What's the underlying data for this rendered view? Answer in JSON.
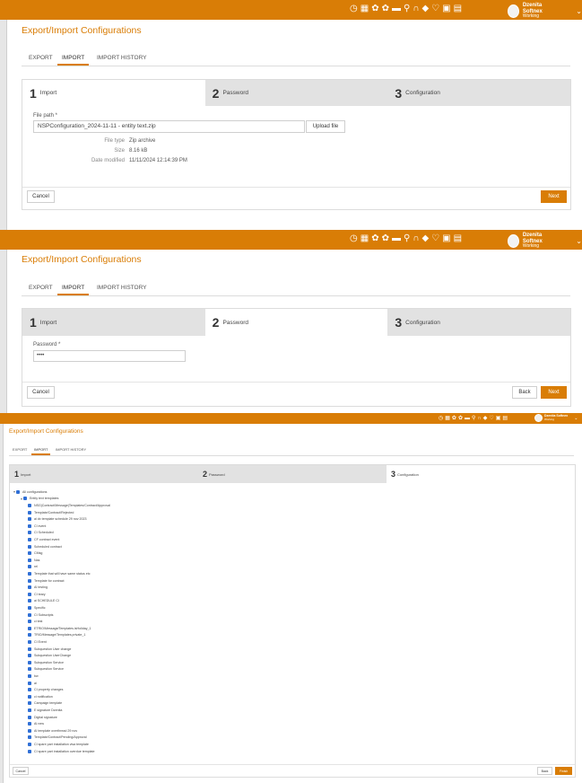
{
  "user": {
    "name": "Dzenita Softnex",
    "status": "Working"
  },
  "topbar_icons": [
    "clock-icon",
    "map-icon",
    "flower-icon",
    "flower-icon",
    "card-icon",
    "search-icon",
    "headset-icon",
    "tag-icon",
    "heart-icon",
    "calendar-icon",
    "chat-icon"
  ],
  "page": {
    "title": "Export/Import Configurations"
  },
  "tabs": [
    "EXPORT",
    "IMPORT",
    "IMPORT HISTORY"
  ],
  "steps": [
    {
      "num": "1",
      "label": "Import"
    },
    {
      "num": "2",
      "label": "Password"
    },
    {
      "num": "3",
      "label": "Configuration"
    }
  ],
  "import_step": {
    "file_path_label": "File path *",
    "file_path_value": "NSPConfiguration_2024-11-11 - entity text.zip",
    "upload_label": "Upload file",
    "info": [
      {
        "label": "File type",
        "value": "Zip archive"
      },
      {
        "label": "Size",
        "value": "8.16 kB"
      },
      {
        "label": "Date modified",
        "value": "11/11/2024 12:14:39 PM"
      }
    ]
  },
  "password_step": {
    "label": "Password *",
    "value": "••••"
  },
  "buttons": {
    "cancel": "Cancel",
    "next": "Next",
    "back": "Back",
    "finish": "Finish"
  },
  "config_tree": {
    "root": "All configurations",
    "group": "Entity text templates",
    "items": [
      "NSG|Contract/Message|Templates/Contract/Approval",
      "Template/Contract/Rejected",
      "ai dx template schedule 29 nov 2023",
      "CI event",
      "CI Scheduled",
      "CF contract event",
      "Scheduled contract",
      "CMsg",
      "Nas",
      "rel",
      "Template that will have same status etc",
      "Template for contract",
      "AI testing",
      "CI teary",
      "ai SCHEDULE CI",
      "Specific",
      "CI Subscripts",
      "ci test",
      "ETRIO/Message/Templates.isHoliday_1",
      "TRIO/Message/Templates.private_1",
      "CI Event",
      "Subquestion User change",
      "Subquestion UserChange",
      "Subquestion Service",
      "Subquestion Service",
      "bw",
      "ai",
      "CI property changes",
      "ci notification",
      "Campaign template",
      "E signature Dzenita",
      "Digital signature",
      "AI new",
      "AI template overthread 29 nov",
      "Template/Contract/Pending/Approval",
      "CI spare part installation visa template",
      "CI spare part installation overdue template"
    ]
  }
}
